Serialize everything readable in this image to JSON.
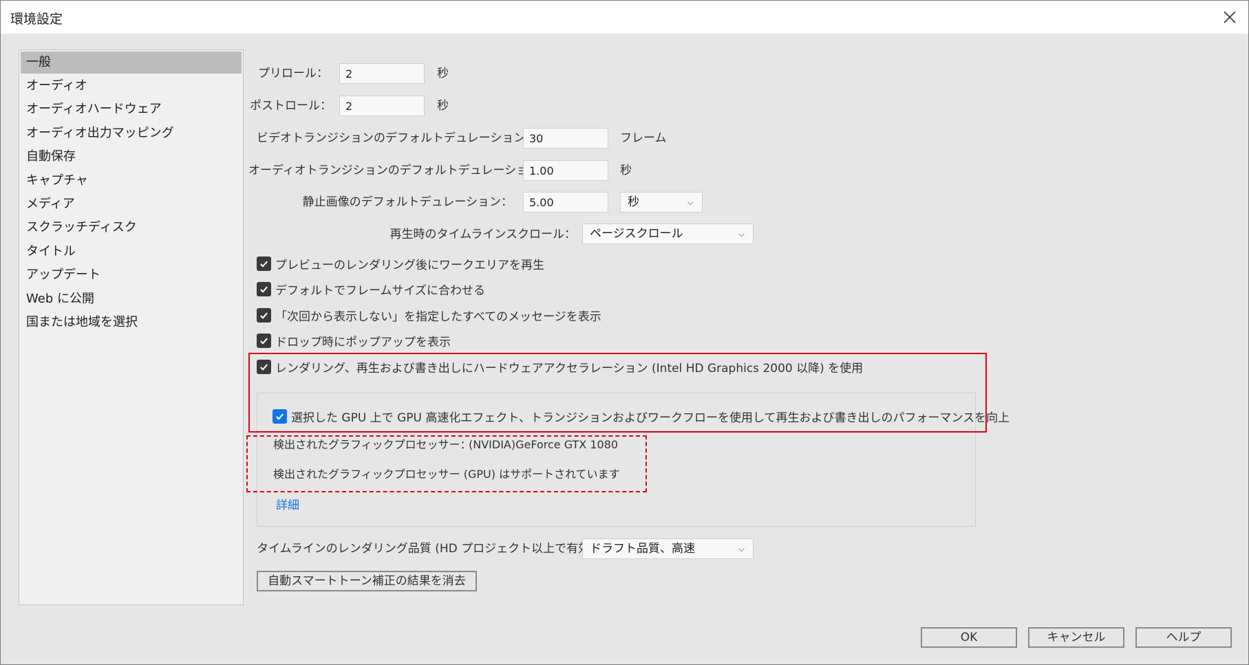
{
  "window": {
    "title": "環境設定"
  },
  "sidebar": {
    "items": [
      {
        "label": "一般"
      },
      {
        "label": "オーディオ"
      },
      {
        "label": "オーディオハードウェア"
      },
      {
        "label": "オーディオ出力マッピング"
      },
      {
        "label": "自動保存"
      },
      {
        "label": "キャプチャ"
      },
      {
        "label": "メディア"
      },
      {
        "label": "スクラッチディスク"
      },
      {
        "label": "タイトル"
      },
      {
        "label": "アップデート"
      },
      {
        "label": "Web に公開"
      },
      {
        "label": "国または地域を選択"
      }
    ],
    "selected": "一般"
  },
  "general": {
    "preroll": {
      "label": "プリロール：",
      "value": "2",
      "unit": "秒"
    },
    "postroll": {
      "label": "ポストロール：",
      "value": "2",
      "unit": "秒"
    },
    "video_transition": {
      "label": "ビデオトランジションのデフォルトデュレーション：",
      "value": "30",
      "unit": "フレーム"
    },
    "audio_transition": {
      "label": "オーディオトランジションのデフォルトデュレーション：",
      "value": "1.00",
      "unit": "秒"
    },
    "still_image": {
      "label": "静止画像のデフォルトデュレーション：",
      "value": "5.00",
      "unit_select": "秒"
    },
    "timeline_scroll": {
      "label": "再生時のタイムラインスクロール：",
      "value": "ページスクロール"
    },
    "checkboxes": [
      {
        "label": "プレビューのレンダリング後にワークエリアを再生",
        "checked": true
      },
      {
        "label": "デフォルトでフレームサイズに合わせる",
        "checked": true
      },
      {
        "label": "「次回から表示しない」を指定したすべてのメッセージを表示",
        "checked": true
      },
      {
        "label": "ドロップ時にポップアップを表示",
        "checked": true
      },
      {
        "label": "レンダリング、再生および書き出しにハードウェアアクセラレーション (Intel HD Graphics 2000 以降) を使用",
        "checked": true
      }
    ],
    "gpu": {
      "accel_label": "選択した GPU 上で GPU 高速化エフェクト、トランジションおよびワークフローを使用して再生および書き出しのパフォーマンスを向上",
      "accel_checked": true,
      "detected_label": "検出されたグラフィックプロセッサー：",
      "detected_value": "(NVIDIA)GeForce GTX 1080",
      "supported_text": "検出されたグラフィックプロセッサー (GPU) はサポートされています",
      "details_link": "詳細"
    },
    "render_quality": {
      "label": "タイムラインのレンダリング品質 (HD プロジェクト以上で有効)：",
      "value": "ドラフト品質、高速"
    },
    "clear_button": "自動スマートトーン補正の結果を消去"
  },
  "footer": {
    "ok": "OK",
    "cancel": "キャンセル",
    "help": "ヘルプ"
  },
  "colors": {
    "accent": "#1473e6",
    "highlight_red": "#e0001b",
    "background": "#e6e6e6"
  }
}
